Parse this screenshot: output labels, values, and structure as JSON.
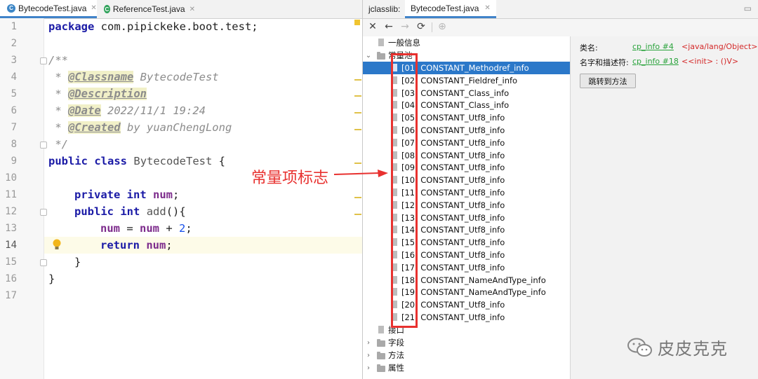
{
  "editor": {
    "tabs": [
      {
        "label": "BytecodeTest.java",
        "icon": "class-c-icon",
        "active": true
      },
      {
        "label": "ReferenceTest.java",
        "icon": "class-c-icon-green",
        "active": false
      }
    ],
    "line_numbers": [
      "1",
      "2",
      "3",
      "4",
      "5",
      "6",
      "7",
      "8",
      "9",
      "10",
      "11",
      "12",
      "13",
      "14",
      "15",
      "16",
      "17"
    ],
    "code": {
      "l1_kw": "package",
      "l1_rest": " com.pipickeke.boot.test;",
      "l3": "/**",
      "l4_star": " * ",
      "l4_tag": "@Classname",
      "l4_rest": " BytecodeTest",
      "l5_star": " * ",
      "l5_tag": "@Description",
      "l6_star": " * ",
      "l6_tag": "@Date",
      "l6_rest": " 2022/11/1 19:24",
      "l7_star": " * ",
      "l7_tag": "@Created",
      "l7_rest": " by yuanChengLong",
      "l8": " */",
      "l9_kw1": "public",
      "l9_kw2": "class",
      "l9_cls": "BytecodeTest",
      "l9_brace": " {",
      "l11_kw1": "private",
      "l11_kw2": "int",
      "l11_fld": "num",
      "l11_end": ";",
      "l12_kw1": "public",
      "l12_kw2": "int",
      "l12_m": "add",
      "l12_end": "(){",
      "l13_fld1": "num",
      "l13_op": " = ",
      "l13_fld2": "num",
      "l13_plus": " + ",
      "l13_num": "2",
      "l13_end": ";",
      "l14_kw": "return",
      "l14_fld": "num",
      "l14_end": ";",
      "l15": "}",
      "l16": "}"
    }
  },
  "jclasslib": {
    "label": "jclasslib:",
    "tab": "BytecodeTest.java",
    "toolbar": [
      "close-icon",
      "back-arrow-icon",
      "forward-arrow-icon",
      "refresh-icon",
      "browser-icon"
    ],
    "tree": {
      "general": "一般信息",
      "constant_pool": "常量池",
      "constants": [
        "[01] CONSTANT_Methodref_info",
        "[02] CONSTANT_Fieldref_info",
        "[03] CONSTANT_Class_info",
        "[04] CONSTANT_Class_info",
        "[05] CONSTANT_Utf8_info",
        "[06] CONSTANT_Utf8_info",
        "[07] CONSTANT_Utf8_info",
        "[08] CONSTANT_Utf8_info",
        "[09] CONSTANT_Utf8_info",
        "[10] CONSTANT_Utf8_info",
        "[11] CONSTANT_Utf8_info",
        "[12] CONSTANT_Utf8_info",
        "[13] CONSTANT_Utf8_info",
        "[14] CONSTANT_Utf8_info",
        "[15] CONSTANT_Utf8_info",
        "[16] CONSTANT_Utf8_info",
        "[17] CONSTANT_Utf8_info",
        "[18] CONSTANT_NameAndType_info",
        "[19] CONSTANT_NameAndType_info",
        "[20] CONSTANT_Utf8_info",
        "[21] CONSTANT_Utf8_info"
      ],
      "selected_index": 0,
      "interfaces": "接口",
      "fields": "字段",
      "methods": "方法",
      "attributes": "属性"
    },
    "detail": {
      "class_name_label": "类名:",
      "class_name_link": "cp_info #4",
      "class_name_value": "<java/lang/Object>",
      "name_desc_label": "名字和描述符:",
      "name_desc_link": "cp_info #18",
      "name_desc_value": "<<init> : ()V>",
      "goto_button": "跳转到方法"
    }
  },
  "annotation": {
    "text": "常量项标志",
    "color": "#e8312f"
  },
  "watermark": "皮皮克克",
  "colors": {
    "selection": "#2b78c9",
    "link": "#2aa33c",
    "value_red": "#d42a2a",
    "keyword": "#1a1aa6",
    "field": "#7d2c8c",
    "number": "#1750eb"
  }
}
